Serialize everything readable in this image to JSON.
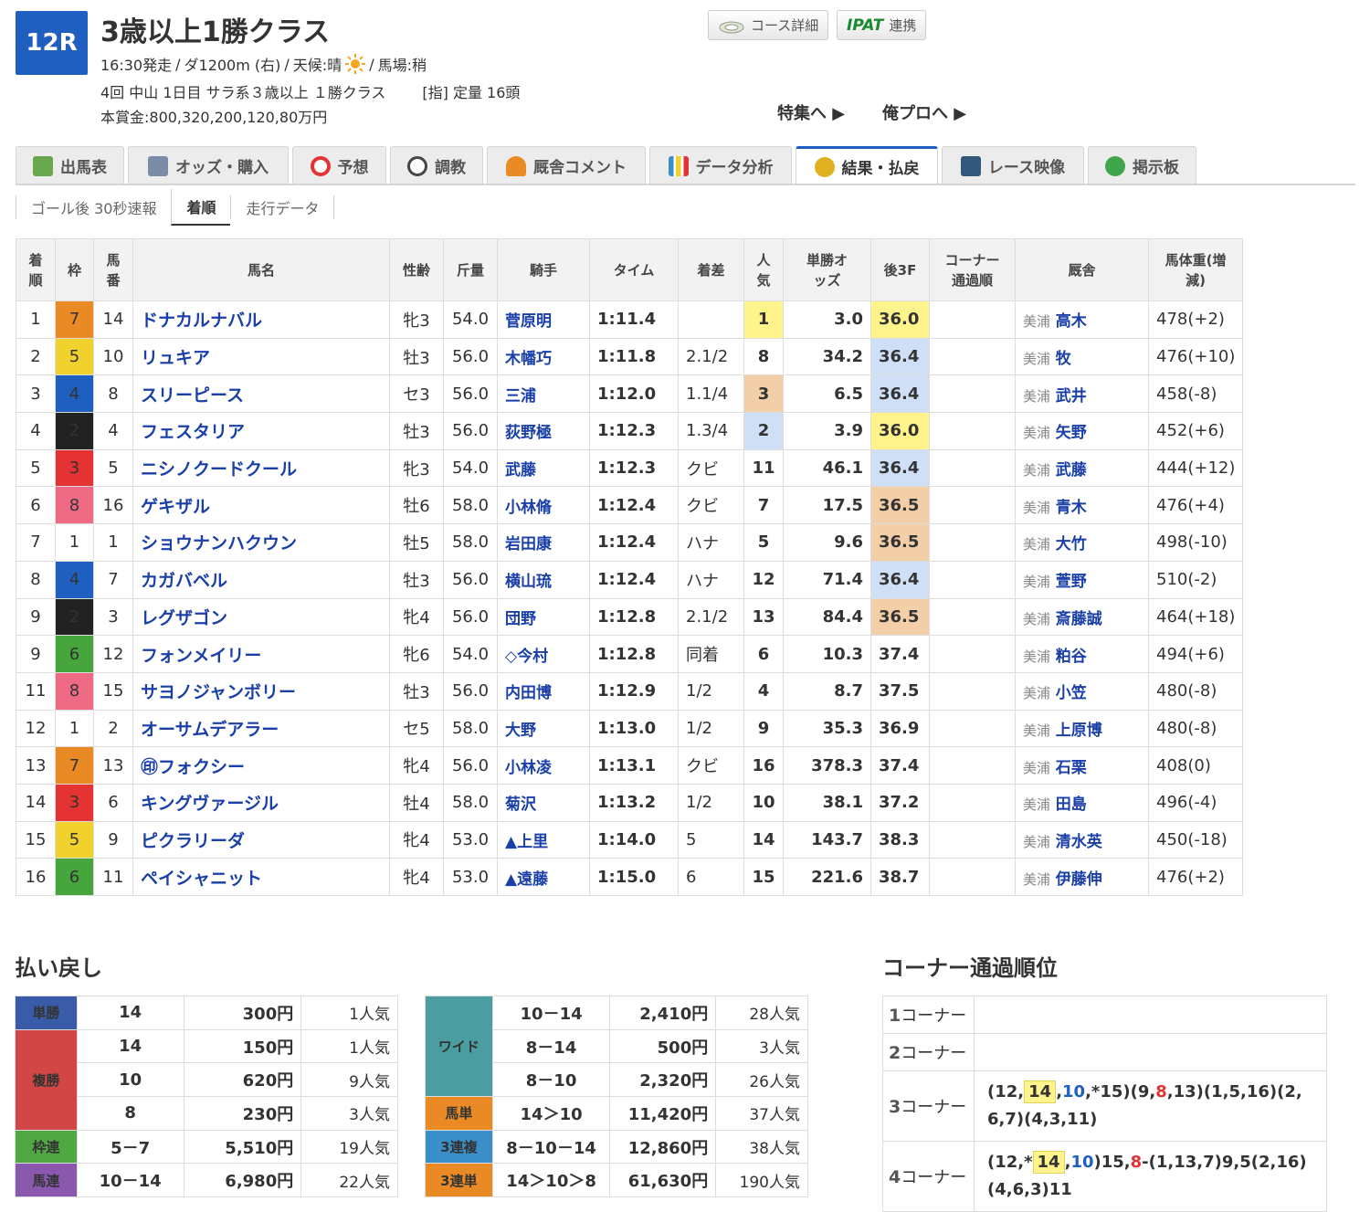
{
  "header": {
    "race_no": "12R",
    "title": "3歳以上1勝クラス",
    "start": "16:30発走",
    "course": "ダ1200m (右)",
    "weather": "天候:晴",
    "track": "馬場:稍",
    "sep": "/",
    "meeting": "4回 中山 1日目 サラ系３歳以上 １勝クラス",
    "conditions": "[指] 定量 16頭",
    "prize": "本賞金:800,320,200,120,80万円"
  },
  "buttons": {
    "course": "コース詳細",
    "ipat_logo": "IPAT",
    "ipat": "連携",
    "feature": "特集へ ▶",
    "orepro": "俺プロへ ▶"
  },
  "tabs": [
    {
      "label": "出馬表"
    },
    {
      "label": "オッズ・購入"
    },
    {
      "label": "予想"
    },
    {
      "label": "調教"
    },
    {
      "label": "厩舎コメント"
    },
    {
      "label": "データ分析"
    },
    {
      "label": "結果・払戻"
    },
    {
      "label": "レース映像"
    },
    {
      "label": "掲示板"
    }
  ],
  "subtabs": [
    "ゴール後 30秒速報",
    "着順",
    "走行データ"
  ],
  "table_headers": {
    "rank": "着順",
    "waku": "枠",
    "umaban": "馬番",
    "name": "馬名",
    "sexage": "性齢",
    "weight": "斤量",
    "jockey": "騎手",
    "time": "タイム",
    "margin": "着差",
    "pop": "人気",
    "odds": "単勝オッズ",
    "last3f": "後3F",
    "corner": "コーナー通過順",
    "stable": "厩舎",
    "body": "馬体重(増減)"
  },
  "results": [
    {
      "rank": "1",
      "waku": "7",
      "no": "14",
      "name": "ドナカルナバル",
      "sa": "牝3",
      "kg": "54.0",
      "jockey": "菅原明",
      "time": "1:11.4",
      "margin": "",
      "pop": "1",
      "odds": "3.0",
      "l3f": "36.0",
      "loc": "美浦",
      "trainer": "高木",
      "body": "478(+2)"
    },
    {
      "rank": "2",
      "waku": "5",
      "no": "10",
      "name": "リュキア",
      "sa": "牡3",
      "kg": "56.0",
      "jockey": "木幡巧",
      "time": "1:11.8",
      "margin": "2.1/2",
      "pop": "8",
      "odds": "34.2",
      "l3f": "36.4",
      "loc": "美浦",
      "trainer": "牧",
      "body": "476(+10)"
    },
    {
      "rank": "3",
      "waku": "4",
      "no": "8",
      "name": "スリーピース",
      "sa": "セ3",
      "kg": "56.0",
      "jockey": "三浦",
      "time": "1:12.0",
      "margin": "1.1/4",
      "pop": "3",
      "odds": "6.5",
      "l3f": "36.4",
      "loc": "美浦",
      "trainer": "武井",
      "body": "458(-8)"
    },
    {
      "rank": "4",
      "waku": "2",
      "no": "4",
      "name": "フェスタリア",
      "sa": "牡3",
      "kg": "56.0",
      "jockey": "荻野極",
      "time": "1:12.3",
      "margin": "1.3/4",
      "pop": "2",
      "odds": "3.9",
      "l3f": "36.0",
      "loc": "美浦",
      "trainer": "矢野",
      "body": "452(+6)"
    },
    {
      "rank": "5",
      "waku": "3",
      "no": "5",
      "name": "ニシノクードクール",
      "sa": "牝3",
      "kg": "54.0",
      "jockey": "武藤",
      "time": "1:12.3",
      "margin": "クビ",
      "pop": "11",
      "odds": "46.1",
      "l3f": "36.4",
      "loc": "美浦",
      "trainer": "武藤",
      "body": "444(+12)"
    },
    {
      "rank": "6",
      "waku": "8",
      "no": "16",
      "name": "ゲキザル",
      "sa": "牡6",
      "kg": "58.0",
      "jockey": "小林脩",
      "time": "1:12.4",
      "margin": "クビ",
      "pop": "7",
      "odds": "17.5",
      "l3f": "36.5",
      "loc": "美浦",
      "trainer": "青木",
      "body": "476(+4)"
    },
    {
      "rank": "7",
      "waku": "1",
      "no": "1",
      "name": "ショウナンハクウン",
      "sa": "牡5",
      "kg": "58.0",
      "jockey": "岩田康",
      "time": "1:12.4",
      "margin": "ハナ",
      "pop": "5",
      "odds": "9.6",
      "l3f": "36.5",
      "loc": "美浦",
      "trainer": "大竹",
      "body": "498(-10)"
    },
    {
      "rank": "8",
      "waku": "4",
      "no": "7",
      "name": "カガバベル",
      "sa": "牡3",
      "kg": "56.0",
      "jockey": "横山琉",
      "time": "1:12.4",
      "margin": "ハナ",
      "pop": "12",
      "odds": "71.4",
      "l3f": "36.4",
      "loc": "美浦",
      "trainer": "萱野",
      "body": "510(-2)"
    },
    {
      "rank": "9",
      "waku": "2",
      "no": "3",
      "name": "レグザゴン",
      "sa": "牝4",
      "kg": "56.0",
      "jockey": "団野",
      "time": "1:12.8",
      "margin": "2.1/2",
      "pop": "13",
      "odds": "84.4",
      "l3f": "36.5",
      "loc": "美浦",
      "trainer": "斎藤誠",
      "body": "464(+18)"
    },
    {
      "rank": "9",
      "waku": "6",
      "no": "12",
      "name": "フォンメイリー",
      "sa": "牝6",
      "kg": "54.0",
      "jockey": "◇今村",
      "time": "1:12.8",
      "margin": "同着",
      "pop": "6",
      "odds": "10.3",
      "l3f": "37.4",
      "loc": "美浦",
      "trainer": "粕谷",
      "body": "494(+6)"
    },
    {
      "rank": "11",
      "waku": "8",
      "no": "15",
      "name": "サヨノジャンボリー",
      "sa": "牡3",
      "kg": "56.0",
      "jockey": "内田博",
      "time": "1:12.9",
      "margin": "1/2",
      "pop": "4",
      "odds": "8.7",
      "l3f": "37.5",
      "loc": "美浦",
      "trainer": "小笠",
      "body": "480(-8)"
    },
    {
      "rank": "12",
      "waku": "1",
      "no": "2",
      "name": "オーサムデアラー",
      "sa": "セ5",
      "kg": "58.0",
      "jockey": "大野",
      "time": "1:13.0",
      "margin": "1/2",
      "pop": "9",
      "odds": "35.3",
      "l3f": "36.9",
      "loc": "美浦",
      "trainer": "上原博",
      "body": "480(-8)"
    },
    {
      "rank": "13",
      "waku": "7",
      "no": "13",
      "name": "㊞フォクシー",
      "sa": "牝4",
      "kg": "56.0",
      "jockey": "小林凌",
      "time": "1:13.1",
      "margin": "クビ",
      "pop": "16",
      "odds": "378.3",
      "l3f": "37.4",
      "loc": "美浦",
      "trainer": "石栗",
      "body": "408(0)"
    },
    {
      "rank": "14",
      "waku": "3",
      "no": "6",
      "name": "キングヴァージル",
      "sa": "牡4",
      "kg": "58.0",
      "jockey": "菊沢",
      "time": "1:13.2",
      "margin": "1/2",
      "pop": "10",
      "odds": "38.1",
      "l3f": "37.2",
      "loc": "美浦",
      "trainer": "田島",
      "body": "496(-4)"
    },
    {
      "rank": "15",
      "waku": "5",
      "no": "9",
      "name": "ピクラリーダ",
      "sa": "牝4",
      "kg": "53.0",
      "jockey": "▲上里",
      "time": "1:14.0",
      "margin": "5",
      "pop": "14",
      "odds": "143.7",
      "l3f": "38.3",
      "loc": "美浦",
      "trainer": "清水英",
      "body": "450(-18)"
    },
    {
      "rank": "16",
      "waku": "6",
      "no": "11",
      "name": "ペイシャニット",
      "sa": "牝4",
      "kg": "53.0",
      "jockey": "▲遠藤",
      "time": "1:15.0",
      "margin": "6",
      "pop": "15",
      "odds": "221.6",
      "l3f": "38.7",
      "loc": "美浦",
      "trainer": "伊藤伸",
      "body": "476(+2)"
    }
  ],
  "payout_title": "払い戻し",
  "payout_left": {
    "tan": {
      "label": "単勝",
      "rows": [
        {
          "comb": "14",
          "amt": "300円",
          "pop": "1人気"
        }
      ]
    },
    "fuku": {
      "label": "複勝",
      "rows": [
        {
          "comb": "14",
          "amt": "150円",
          "pop": "1人気"
        },
        {
          "comb": "10",
          "amt": "620円",
          "pop": "9人気"
        },
        {
          "comb": "8",
          "amt": "230円",
          "pop": "3人気"
        }
      ]
    },
    "waku": {
      "label": "枠連",
      "rows": [
        {
          "comb": "5－7",
          "amt": "5,510円",
          "pop": "19人気"
        }
      ]
    },
    "uren": {
      "label": "馬連",
      "rows": [
        {
          "comb": "10－14",
          "amt": "6,980円",
          "pop": "22人気"
        }
      ]
    }
  },
  "payout_right": {
    "wide": {
      "label": "ワイド",
      "rows": [
        {
          "comb": "10－14",
          "amt": "2,410円",
          "pop": "28人気"
        },
        {
          "comb": "8－14",
          "amt": "500円",
          "pop": "3人気"
        },
        {
          "comb": "8－10",
          "amt": "2,320円",
          "pop": "26人気"
        }
      ]
    },
    "utan": {
      "label": "馬単",
      "rows": [
        {
          "comb": "14＞10",
          "amt": "11,420円",
          "pop": "37人気"
        }
      ]
    },
    "fuku3": {
      "label": "3連複",
      "rows": [
        {
          "comb": "8－10－14",
          "amt": "12,860円",
          "pop": "38人気"
        }
      ]
    },
    "tan3": {
      "label": "3連単",
      "rows": [
        {
          "comb": "14＞10＞8",
          "amt": "61,630円",
          "pop": "190人気"
        }
      ]
    }
  },
  "corner_title": "コーナー通過順位",
  "corners": [
    {
      "num": "1",
      "suffix": "コーナー"
    },
    {
      "num": "2",
      "suffix": "コーナー"
    },
    {
      "num": "3",
      "suffix": "コーナー"
    },
    {
      "num": "4",
      "suffix": "コーナー"
    }
  ],
  "colors": {
    "accent": "#1f5fbf",
    "link": "#1a3fa8",
    "highlight": "#fff48c",
    "red": "#e53333"
  }
}
